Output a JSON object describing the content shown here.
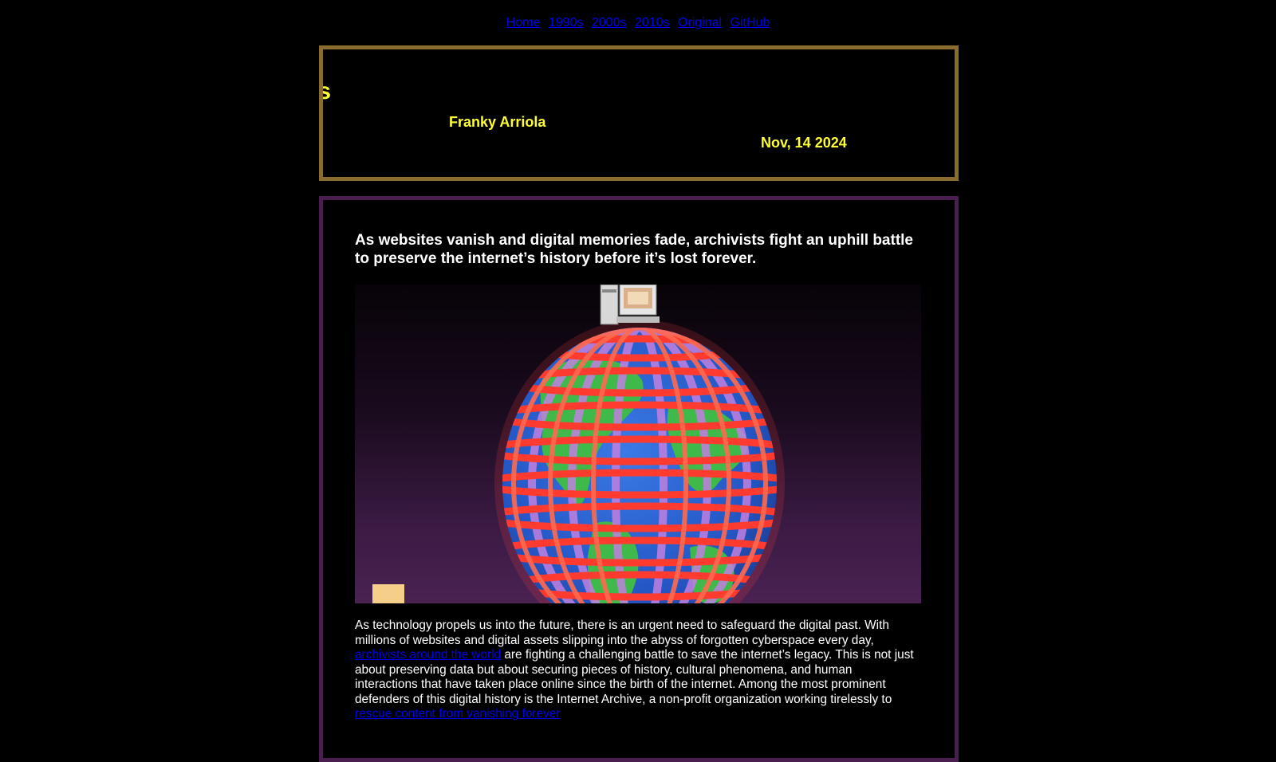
{
  "nav": {
    "items": [
      {
        "label": "Home"
      },
      {
        "label": "1990s"
      },
      {
        "label": "2000s"
      },
      {
        "label": "2010s"
      },
      {
        "label": "Original"
      },
      {
        "label": "GitHub"
      }
    ]
  },
  "header": {
    "title_visible": "pears",
    "author": "Franky Arriola",
    "date": "Nov, 14 2024"
  },
  "article": {
    "subtitle": "As websites vanish and digital memories fade, archivists fight an uphill battle to preserve the internet’s history before it’s lost forever.",
    "hero_image": "globe-with-computer-image",
    "paragraph": {
      "part1": "As technology propels us into the future, there is an urgent need to safeguard the digital past. With millions of websites and digital assets slipping into the abyss of forgotten cyberspace every day, ",
      "link1": "archivists around the world",
      "part2": " are fighting a challenging battle to save the internet’s legacy. This is not just about preserving data but about securing pieces of history, cultural phenomena, and human interactions that have taken place online since the birth of the internet. Among the most prominent defenders of this digital history is the Internet Archive, a non-profit organization working tirelessly to ",
      "link2": "rescue content from vanishing forever"
    }
  },
  "colors": {
    "header_border": "#8a6d2e",
    "content_border": "#4a1e4e",
    "title_yellow": "#ffff33",
    "link_blue": "#0000ee"
  }
}
